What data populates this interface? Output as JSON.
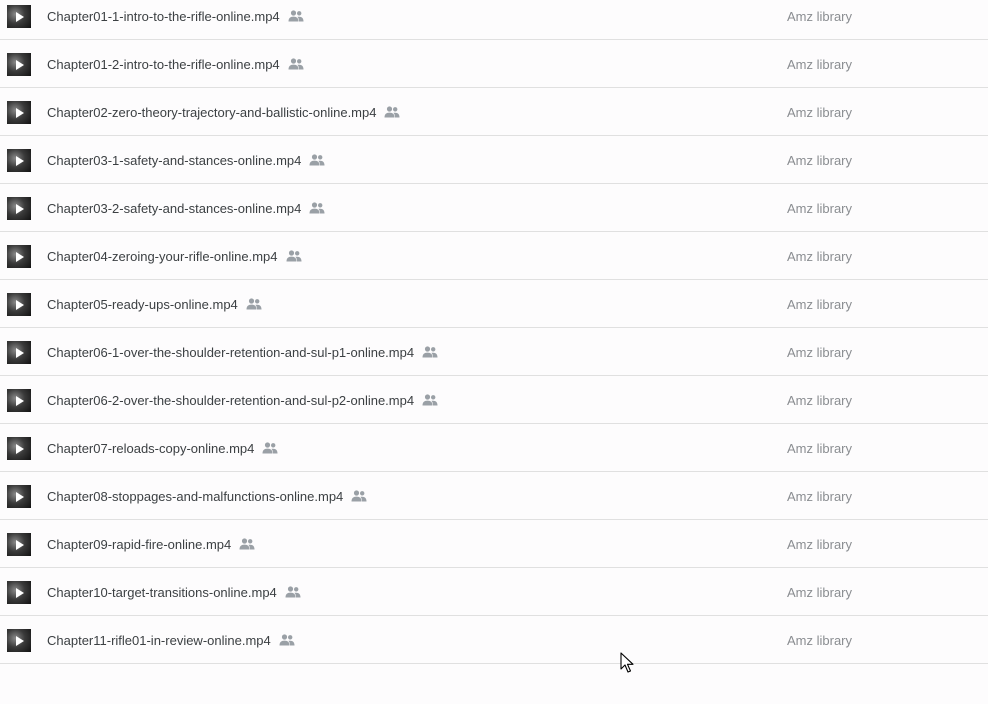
{
  "files": [
    {
      "name": "Chapter01-1-intro-to-the-rifle-online.mp4",
      "owner": "Amz library"
    },
    {
      "name": "Chapter01-2-intro-to-the-rifle-online.mp4",
      "owner": "Amz library"
    },
    {
      "name": "Chapter02-zero-theory-trajectory-and-ballistic-online.mp4",
      "owner": "Amz library"
    },
    {
      "name": "Chapter03-1-safety-and-stances-online.mp4",
      "owner": "Amz library"
    },
    {
      "name": "Chapter03-2-safety-and-stances-online.mp4",
      "owner": "Amz library"
    },
    {
      "name": "Chapter04-zeroing-your-rifle-online.mp4",
      "owner": "Amz library"
    },
    {
      "name": "Chapter05-ready-ups-online.mp4",
      "owner": "Amz library"
    },
    {
      "name": "Chapter06-1-over-the-shoulder-retention-and-sul-p1-online.mp4",
      "owner": "Amz library"
    },
    {
      "name": "Chapter06-2-over-the-shoulder-retention-and-sul-p2-online.mp4",
      "owner": "Amz library"
    },
    {
      "name": "Chapter07-reloads-copy-online.mp4",
      "owner": "Amz library"
    },
    {
      "name": "Chapter08-stoppages-and-malfunctions-online.mp4",
      "owner": "Amz library"
    },
    {
      "name": "Chapter09-rapid-fire-online.mp4",
      "owner": "Amz library"
    },
    {
      "name": "Chapter10-target-transitions-online.mp4",
      "owner": "Amz library"
    },
    {
      "name": "Chapter11-rifle01-in-review-online.mp4",
      "owner": "Amz library"
    }
  ],
  "icons": {
    "thumbnail": "video-thumbnail-icon",
    "play": "play-icon",
    "shared": "shared-people-icon",
    "cursor": "mouse-pointer-icon"
  },
  "colors": {
    "background": "#fdfcfd",
    "divider": "#e0e0e0",
    "file_name_text": "#3c4043",
    "owner_text": "#8a8d91",
    "shared_icon": "#9aa0a6"
  }
}
